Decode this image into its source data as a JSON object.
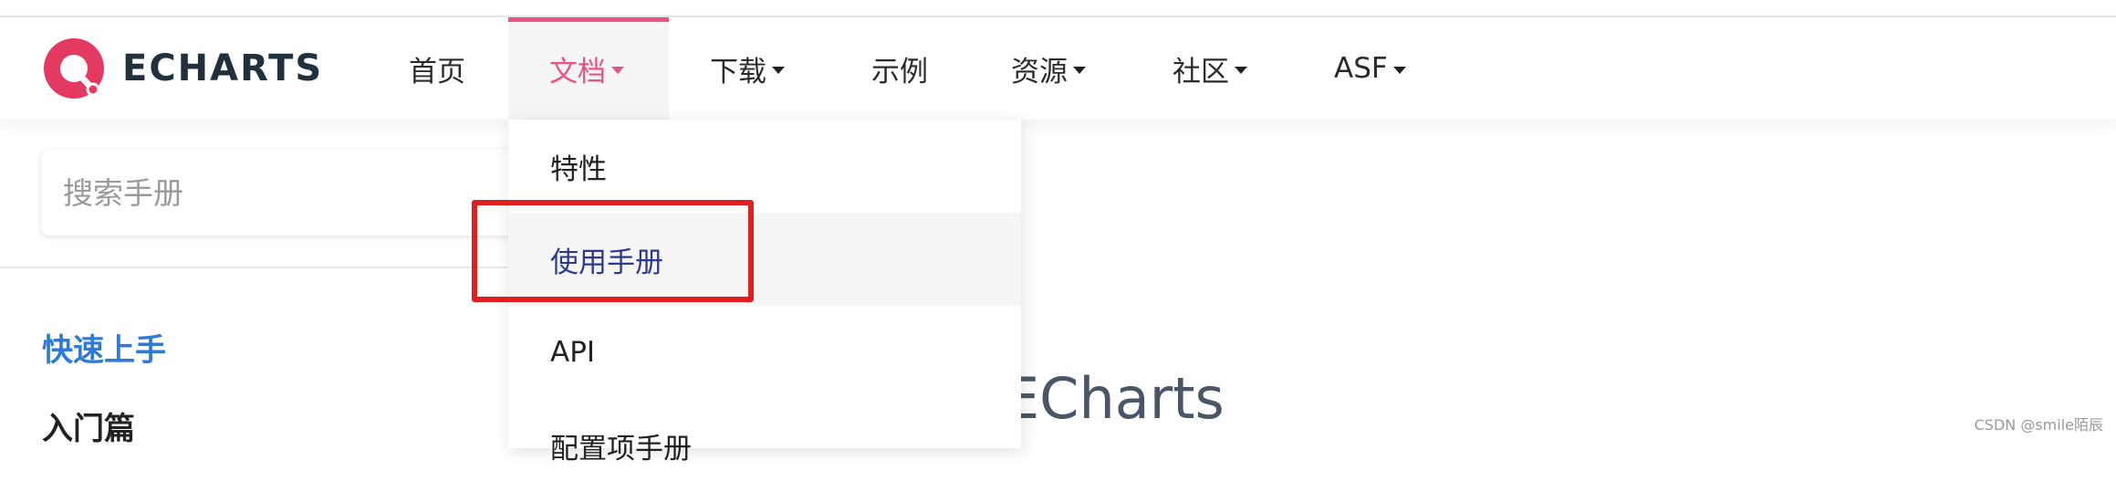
{
  "nav": {
    "logo_text": "ECHARTS",
    "items": [
      {
        "label": "首页",
        "caret": false
      },
      {
        "label": "文档",
        "caret": true,
        "active": true
      },
      {
        "label": "下载",
        "caret": true
      },
      {
        "label": "示例",
        "caret": false
      },
      {
        "label": "资源",
        "caret": true
      },
      {
        "label": "社区",
        "caret": true
      },
      {
        "label": "ASF",
        "caret": true
      }
    ],
    "accent_color": "#e8537f"
  },
  "dropdown": {
    "items": [
      "特性",
      "使用手册",
      "API",
      "配置项手册"
    ],
    "highlighted_index": 1
  },
  "sidebar": {
    "search_placeholder": "搜索手册",
    "section_active": "快速上手",
    "section_next": "入门篇"
  },
  "main": {
    "title_fragment": "ECharts"
  },
  "watermark": "CSDN @smile陌辰"
}
